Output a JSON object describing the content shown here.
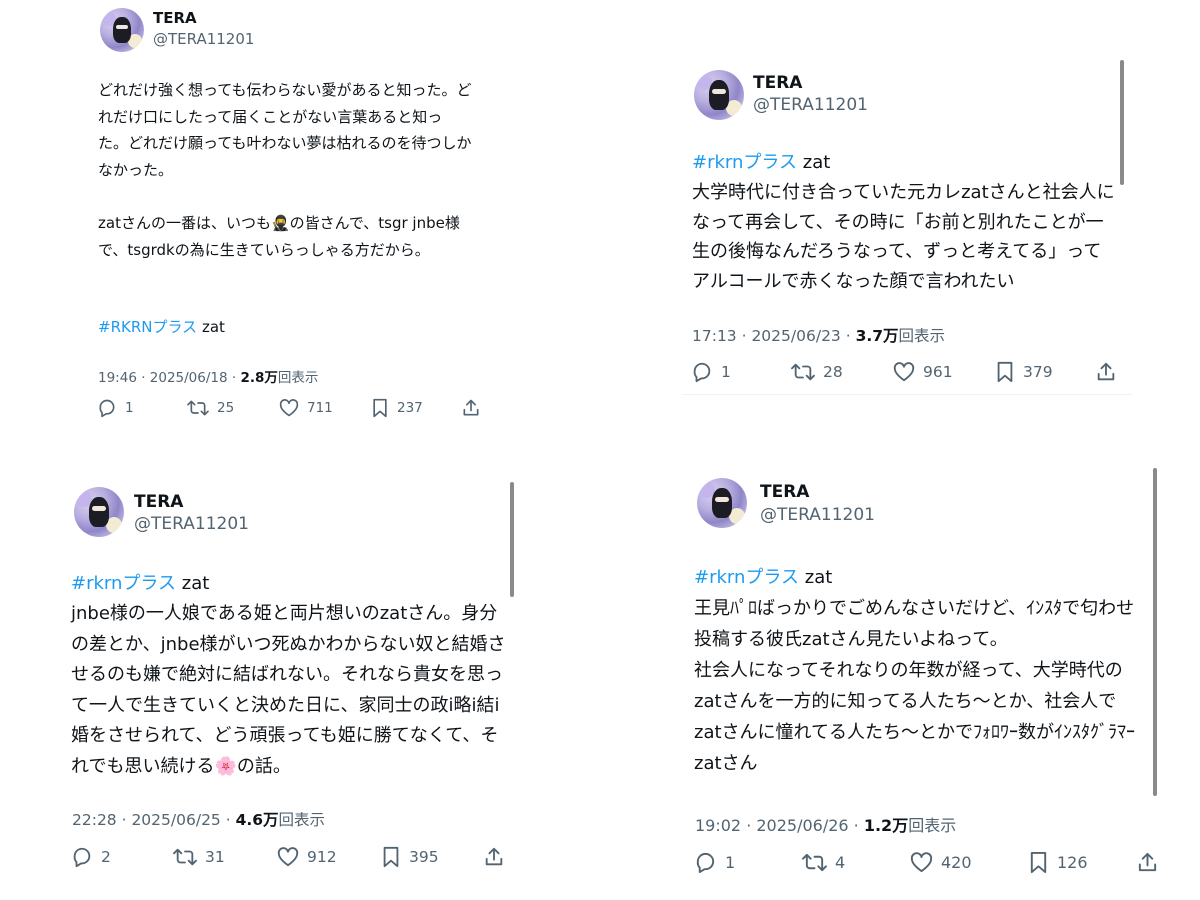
{
  "posts": [
    {
      "name": "TERA",
      "handle": "@TERA11201",
      "body": "どれだけ強く想っても伝わらない愛があると知った。どれだけ口にしたって届くことがない言葉あると知った。どれだけ願っても叶わない夢は枯れるのを待つしかなかった。\n\nzatさんの一番は、いつも🥷の皆さんで、tsgr jnbe様で、tsgrdkの為に生きていらっしゃる方だから。",
      "hashtag": "#RKRNプラス",
      "tag_suffix": " zat",
      "time": "19:46 · 2025/06/18 · ",
      "views": "2.8万",
      "views_suffix": "回表示",
      "replies": "1",
      "reposts": "25",
      "likes": "711",
      "bookmarks": "237"
    },
    {
      "name": "TERA",
      "handle": "@TERA11201",
      "hashtag": "#rkrnプラス",
      "tag_suffix": " zat",
      "body": "大学時代に付き合っていた元カレzatさんと社会人になって再会して、その時に「お前と別れたことが一生の後悔なんだろうなって、ずっと考えてる」ってアルコールで赤くなった顔で言われたい",
      "time": "17:13 · 2025/06/23 · ",
      "views": "3.7万",
      "views_suffix": "回表示",
      "replies": "1",
      "reposts": "28",
      "likes": "961",
      "bookmarks": "379"
    },
    {
      "name": "TERA",
      "handle": "@TERA11201",
      "hashtag": "#rkrnプラス",
      "tag_suffix": " zat",
      "body": "jnbe様の一人娘である姫と両片想いのzatさん。身分の差とか、jnbe様がいつ死ぬかわからない奴と結婚させるのも嫌で絶対に結ばれない。それなら貴女を思って一人で生きていくと決めた日に、家同士の政i略i結i婚をさせられて、どう頑張っても姫に勝てなくて、それでも思い続ける🌸の話。",
      "time": "22:28 · 2025/06/25 · ",
      "views": "4.6万",
      "views_suffix": "回表示",
      "replies": "2",
      "reposts": "31",
      "likes": "912",
      "bookmarks": "395"
    },
    {
      "name": "TERA",
      "handle": "@TERA11201",
      "hashtag": "#rkrnプラス",
      "tag_suffix": " zat",
      "body": "王見ﾊﾟﾛばっかりでごめんなさいだけど、ｲﾝｽﾀで匂わせ投稿する彼氏zatさん見たいよねって。\n社会人になってそれなりの年数が経って、大学時代のzatさんを一方的に知ってる人たち〜とか、社会人でzatさんに憧れてる人たち〜とかでﾌｫﾛﾜｰ数がｲﾝｽﾀｸﾞﾗﾏｰzatさん",
      "time": "19:02 · 2025/06/26 · ",
      "views": "1.2万",
      "views_suffix": "回表示",
      "replies": "1",
      "reposts": "4",
      "likes": "420",
      "bookmarks": "126"
    }
  ],
  "icons": [
    "reply-icon",
    "repost-icon",
    "like-icon",
    "bookmark-icon",
    "share-icon"
  ],
  "colors": {
    "hashtag": "#1d9bf0",
    "secondary_text": "#536471",
    "text": "#0f1419"
  }
}
